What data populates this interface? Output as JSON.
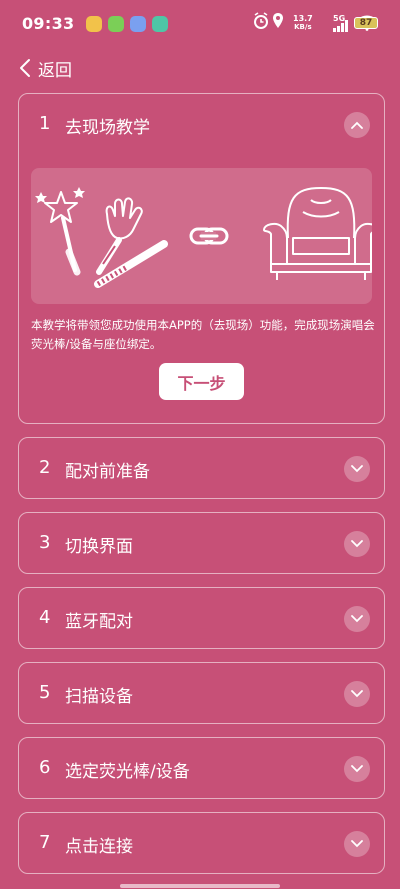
{
  "status_bar": {
    "time": "09:33",
    "network_speed_value": "13.7",
    "network_speed_unit": "KB/s",
    "network_type": "5G",
    "battery": "87",
    "app_icon_colors": [
      "#f2c24a",
      "#7bcf57",
      "#7aa0f0",
      "#4fc6a6"
    ]
  },
  "header": {
    "back_label": "返回"
  },
  "steps": [
    {
      "number": "1",
      "title": "去现场教学",
      "expanded": true,
      "description": "本教学将带领您成功使用本APP的（去现场）功能，完成现场演唱会荧光棒/设备与座位绑定。",
      "next_label": "下一步"
    },
    {
      "number": "2",
      "title": "配对前准备",
      "expanded": false
    },
    {
      "number": "3",
      "title": "切换界面",
      "expanded": false
    },
    {
      "number": "4",
      "title": "蓝牙配对",
      "expanded": false
    },
    {
      "number": "5",
      "title": "扫描设备",
      "expanded": false
    },
    {
      "number": "6",
      "title": "选定荧光棒/设备",
      "expanded": false
    },
    {
      "number": "7",
      "title": "点击连接",
      "expanded": false
    }
  ],
  "icons": {
    "back": "chevron-left-icon",
    "collapse": "chevron-up-icon",
    "expand": "chevron-down-icon",
    "illustration": [
      "magic-wand-icon",
      "clapper-hand-icon",
      "glow-stick-icon",
      "link-icon",
      "seat-chair-icon"
    ]
  },
  "colors": {
    "background": "#c75077",
    "button_bg": "#ffffff",
    "button_text": "#c75077"
  }
}
